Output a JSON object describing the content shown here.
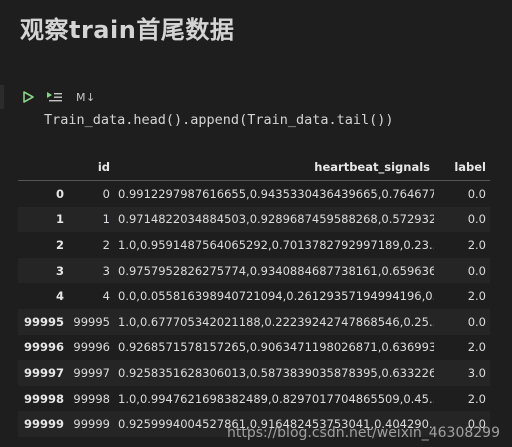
{
  "heading": "观察train首尾数据",
  "toolbar": {
    "run_icon": "play-icon",
    "run_below_icon": "run-below-icon",
    "markdown_label": "M↓"
  },
  "code": "Train_data.head().append(Train_data.tail())",
  "table": {
    "columns": [
      "",
      "id",
      "heartbeat_signals",
      "label"
    ],
    "rows": [
      {
        "index": "0",
        "id": "0",
        "signals": "0.9912297987616655,0.9435330436439665,0.764677...",
        "label": "0.0"
      },
      {
        "index": "1",
        "id": "1",
        "signals": "0.9714822034884503,0.9289687459588268,0.572932...",
        "label": "0.0"
      },
      {
        "index": "2",
        "id": "2",
        "signals": "1.0,0.9591487564065292,0.7013782792997189,0.23...",
        "label": "2.0"
      },
      {
        "index": "3",
        "id": "3",
        "signals": "0.9757952826275774,0.9340884687738161,0.659636...",
        "label": "0.0"
      },
      {
        "index": "4",
        "id": "4",
        "signals": "0.0,0.055816398940721094,0.26129357194994196,0...",
        "label": "2.0"
      },
      {
        "index": "99995",
        "id": "99995",
        "signals": "1.0,0.677705342021188,0.22239242747868546,0.25...",
        "label": "0.0"
      },
      {
        "index": "99996",
        "id": "99996",
        "signals": "0.9268571578157265,0.9063471198026871,0.636993...",
        "label": "2.0"
      },
      {
        "index": "99997",
        "id": "99997",
        "signals": "0.9258351628306013,0.5873839035878395,0.633226...",
        "label": "3.0"
      },
      {
        "index": "99998",
        "id": "99998",
        "signals": "1.0,0.9947621698382489,0.8297017704865509,0.45...",
        "label": "2.0"
      },
      {
        "index": "99999",
        "id": "99999",
        "signals": "0.9259994004527861,0.916482453753041,0.404290...",
        "label": "0.0"
      }
    ]
  },
  "watermark": "https://blog.csdn.net/weixin_46308299",
  "colors": {
    "background": "#1e1e1e",
    "run_icon": "#89d185",
    "text": "#d4d4d4"
  }
}
